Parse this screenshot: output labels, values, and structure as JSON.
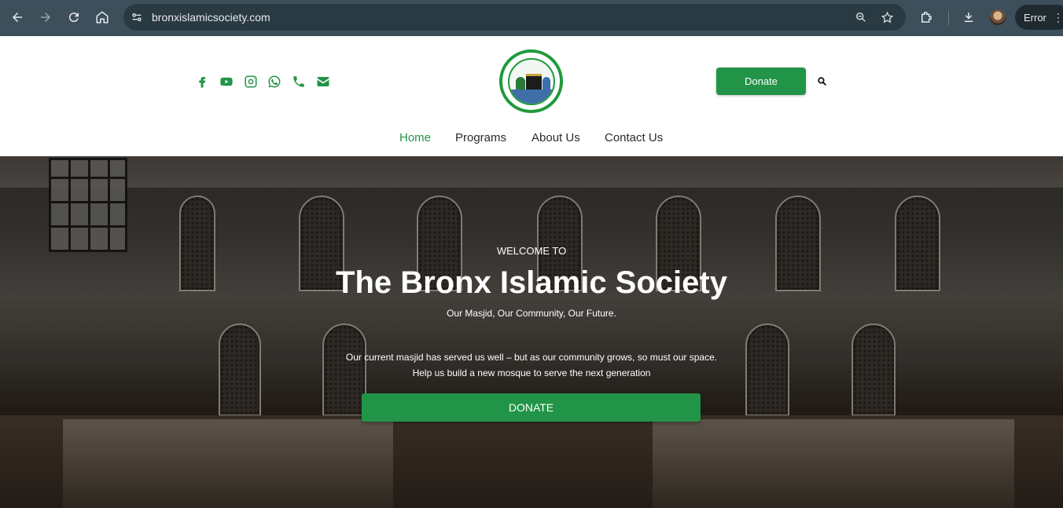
{
  "browser": {
    "url": "bronxislamicsociety.com",
    "profile_status": "Error"
  },
  "header": {
    "social_icons": [
      "facebook-icon",
      "youtube-icon",
      "instagram-icon",
      "whatsapp-icon",
      "phone-icon",
      "email-icon"
    ],
    "donate_label": "Donate",
    "nav": [
      "Home",
      "Programs",
      "About Us",
      "Contact Us"
    ],
    "active_nav": "Home"
  },
  "hero": {
    "welcome": "WELCOME TO",
    "title": "The Bronx Islamic Society",
    "tagline": "Our Masjid, Our Community, Our Future.",
    "description_line1": "Our current masjid has served us well – but as our community grows, so must our space.",
    "description_line2": "Help us build a new mosque to serve the next generation",
    "donate_label": "DONATE"
  },
  "colors": {
    "brand_green": "#229447",
    "chrome_bg": "#3c4f5a"
  }
}
